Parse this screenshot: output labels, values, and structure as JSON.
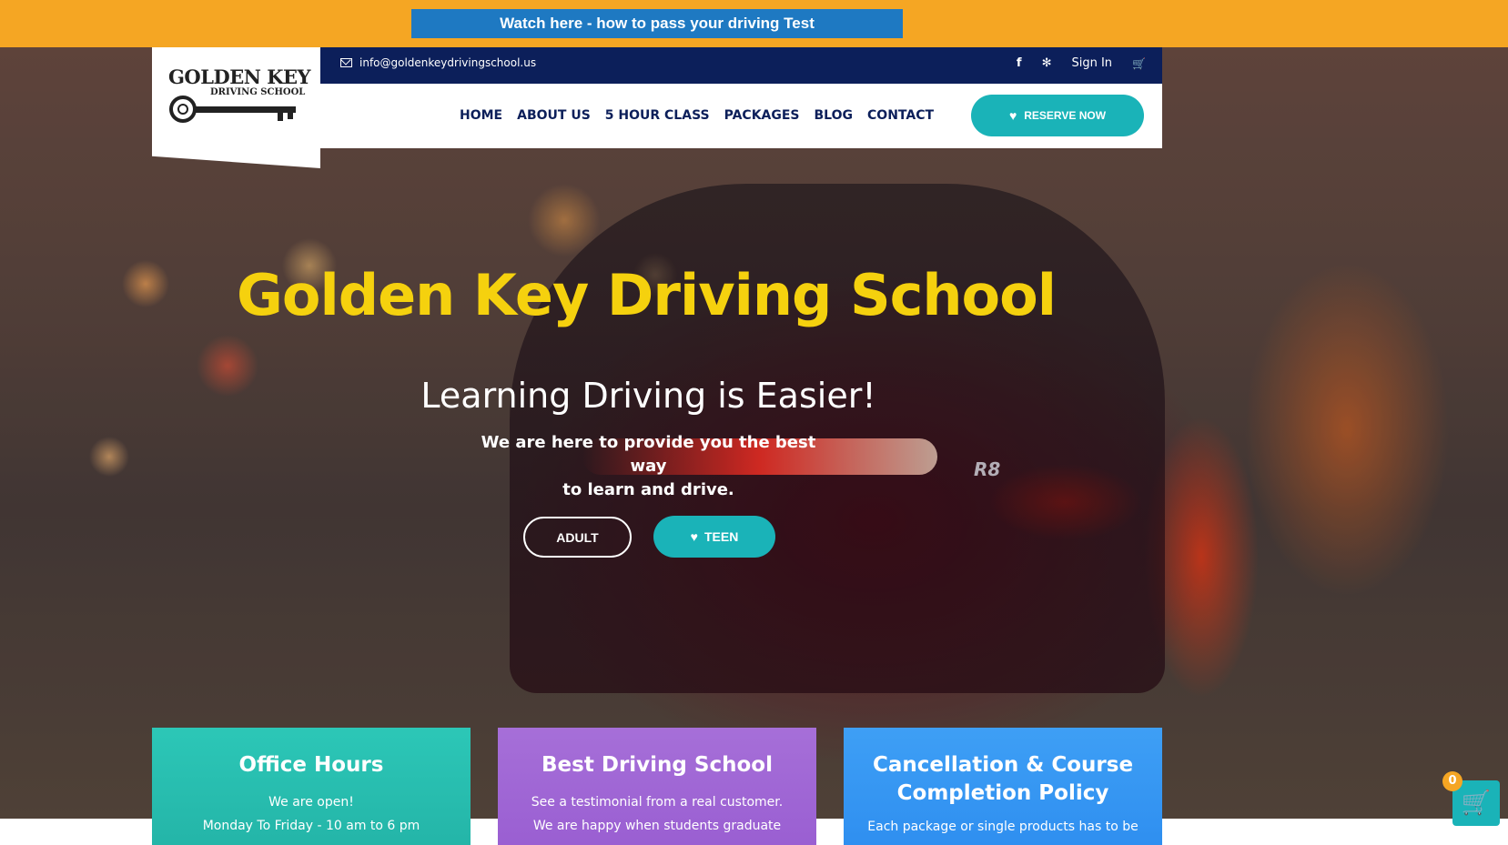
{
  "topbar": {
    "watch_label": "Watch here - how to pass your driving Test"
  },
  "logo": {
    "title": "GOLDEN KEY",
    "subtitle": "DRIVING SCHOOL"
  },
  "infobar": {
    "email": "info@goldenkeydrivingschool.us",
    "sign_in": "Sign In"
  },
  "nav": {
    "items": [
      "HOME",
      "ABOUT US",
      "5 HOUR CLASS",
      "PACKAGES",
      "BLOG",
      "CONTACT"
    ],
    "reserve_label": "RESERVE NOW"
  },
  "hero": {
    "title": "Golden Key Driving School",
    "subtitle": "Learning Driving is Easier!",
    "text_line1": "We are here to provide you the best way",
    "text_line2": "to learn and drive.",
    "adult_label": "ADULT",
    "teen_label": "TEEN",
    "badge": "R8"
  },
  "cards": [
    {
      "title": "Office Hours",
      "line1": "We are open!",
      "line2": "Monday To Friday - 10 am to 6 pm"
    },
    {
      "title": "Best Driving School",
      "line1": "See a testimonial from a real customer.",
      "line2": "We are happy when students graduate"
    },
    {
      "title_line1": "Cancellation & Course",
      "title_line2": "Completion Policy",
      "line1": "Each package or single products has to be"
    }
  ],
  "cart": {
    "count": "0"
  },
  "colors": {
    "topbar": "#f5a623",
    "navy": "#0c1f5a",
    "teal": "#1ab3b8",
    "gold": "#f5d10e",
    "watch_blue": "#1e79c2"
  }
}
